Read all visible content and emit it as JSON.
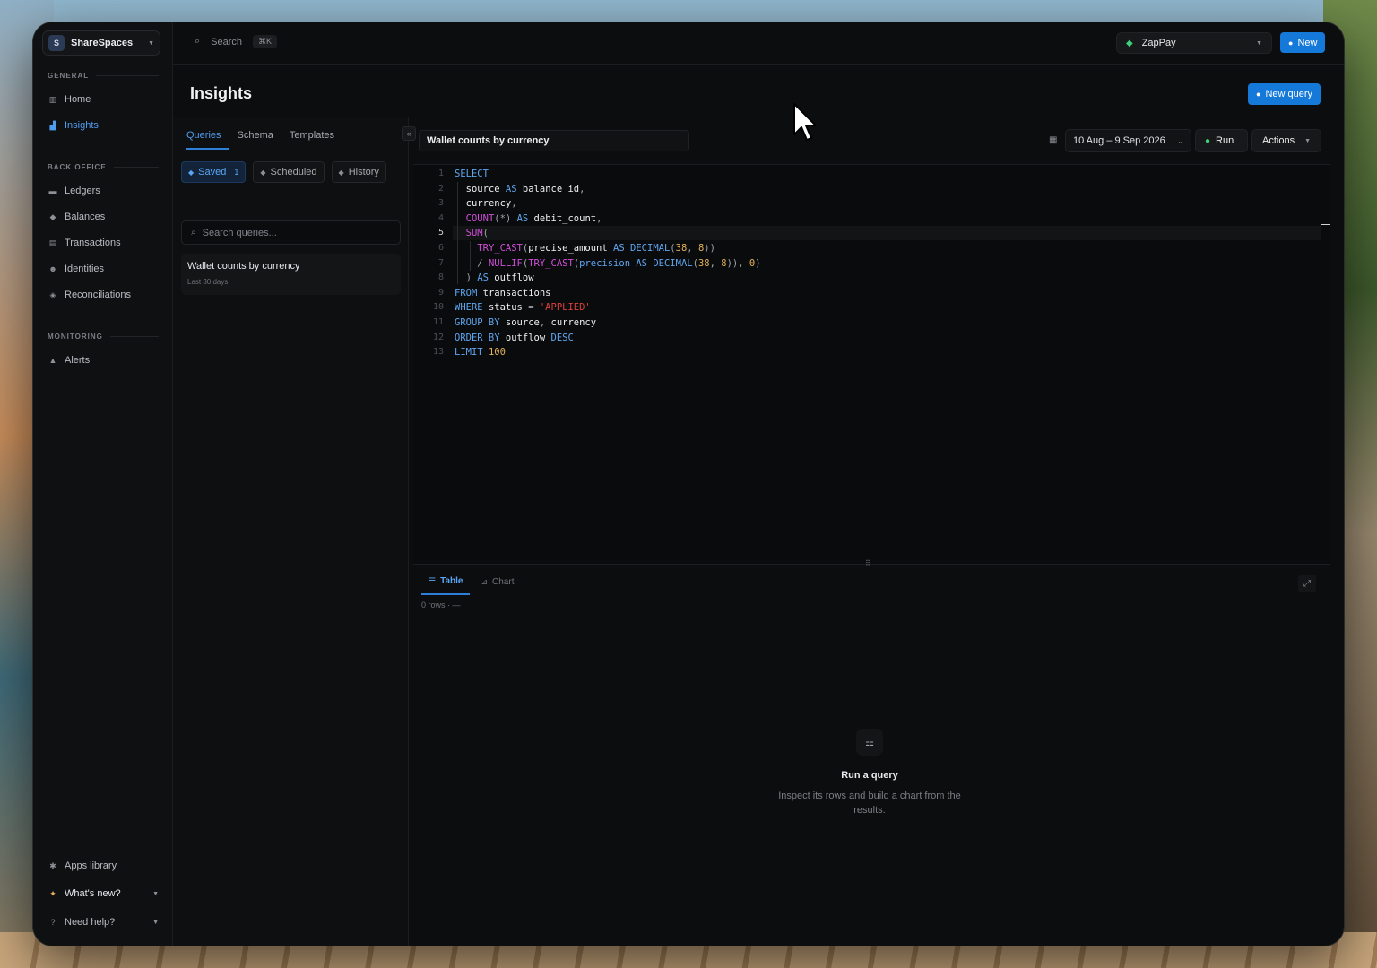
{
  "workspace": {
    "avatar": "S",
    "name": "ShareSpaces"
  },
  "sidebar": {
    "sections": [
      {
        "label": "GENERAL",
        "items": [
          {
            "icon": "home-icon",
            "glyph": "▥",
            "label": "Home"
          },
          {
            "icon": "bar-chart-icon",
            "glyph": "▟",
            "label": "Insights",
            "active": true
          }
        ]
      },
      {
        "label": "BACK OFFICE",
        "items": [
          {
            "icon": "folder-icon",
            "glyph": "▬",
            "label": "Ledgers"
          },
          {
            "icon": "balance-icon",
            "glyph": "◆",
            "label": "Balances"
          },
          {
            "icon": "transaction-icon",
            "glyph": "▤",
            "label": "Transactions"
          },
          {
            "icon": "users-icon",
            "glyph": "☻",
            "label": "Identities"
          },
          {
            "icon": "reconcile-icon",
            "glyph": "◈",
            "label": "Reconciliations"
          }
        ]
      },
      {
        "label": "MONITORING",
        "items": [
          {
            "icon": "bell-icon",
            "glyph": "▲",
            "label": "Alerts"
          }
        ]
      }
    ],
    "footer": [
      {
        "icon": "puzzle-icon",
        "glyph": "✱",
        "label": "Apps library"
      },
      {
        "icon": "sparkle-icon",
        "glyph": "✦",
        "label": "What's new?"
      },
      {
        "icon": "help-icon",
        "glyph": "?",
        "label": "Need help?"
      }
    ]
  },
  "topbar": {
    "search_label": "Search",
    "search_shortcut": "⌘K",
    "org_name": "ZapPay",
    "new_label": "New"
  },
  "page": {
    "title": "Insights",
    "new_query_label": "New query"
  },
  "queries_panel": {
    "tabs": [
      "Queries",
      "Schema",
      "Templates"
    ],
    "chips": [
      {
        "label": "Saved",
        "count": "1",
        "active": true
      },
      {
        "label": "Scheduled"
      },
      {
        "label": "History"
      }
    ],
    "search_placeholder": "Search queries...",
    "items": [
      {
        "title": "Wallet counts by currency",
        "subtitle": "Last 30 days"
      }
    ]
  },
  "editor": {
    "query_name": "Wallet counts by currency",
    "date_range": "10 Aug – 9 Sep 2026",
    "run_label": "Run",
    "actions_label": "Actions",
    "current_line": 5
  },
  "results": {
    "tabs": [
      "Table",
      "Chart"
    ],
    "row_count": "0 rows · —",
    "empty_title": "Run a query",
    "empty_subtitle": "Inspect its rows and build a chart from the results."
  },
  "colors": {
    "accent": "#1479d9",
    "run_icon": "#3ecf7a",
    "keyword": "#5fa6f0",
    "function": "#d04fd8",
    "number": "#e5b25a",
    "string": "#d9413c"
  }
}
